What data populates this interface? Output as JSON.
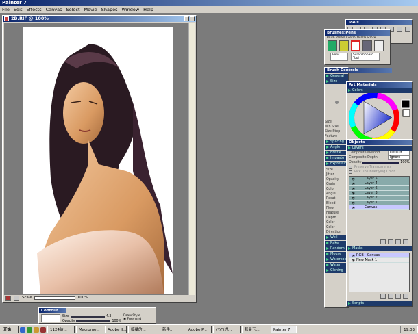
{
  "app": {
    "title": "Painter 7"
  },
  "menu": [
    "File",
    "Edit",
    "Effects",
    "Canvas",
    "Select",
    "Movie",
    "Shapes",
    "Window",
    "Help"
  ],
  "document": {
    "title": "2B.RIF @ 100%",
    "scale_label": "Scale",
    "zoom": "100%"
  },
  "tools": {
    "title": "Tools"
  },
  "brushes": {
    "title": "Brushes:Pens",
    "tabs": "Brush  Variant Control  Nozzle  Stroke",
    "category": "Pens",
    "variant": "Scratchboard Tool"
  },
  "brush_controls": {
    "title": "Brush Controls",
    "general": "General",
    "size": "Size",
    "opacity": "Opacity 100%",
    "labels": [
      "Size",
      "Min Size",
      "Size Step",
      "Feature"
    ],
    "sections": [
      "Spacing",
      "Angle",
      "Bristle",
      "Impasto",
      "Expression"
    ],
    "expr_labels": [
      "Size",
      "Jitter",
      "Opacity",
      "Grain",
      "Color",
      "Angle",
      "Resat",
      "Bleed",
      "Flow",
      "Feature",
      "Depth",
      "Color",
      "Color",
      "Direction"
    ],
    "sections2": [
      "Well",
      "Rake",
      "Random",
      "Mouse",
      "Watercolor",
      "Water",
      "Cloning"
    ]
  },
  "art_materials": {
    "title": "Art Materials",
    "colors": "Colors"
  },
  "objects": {
    "title": "Objects",
    "layers": "Layers",
    "composite_method_label": "Composite Method",
    "composite_method": "Default",
    "composite_depth_label": "Composite Depth",
    "composite_depth": "Ignore",
    "opacity_label": "Opacity",
    "opacity": "100%",
    "preserve": "Preserve Transparency",
    "pick": "Pick Up Underlying Color",
    "layers_list": [
      "Layer 5",
      "Layer 4",
      "Layer 6",
      "Layer 3",
      "Layer 2",
      "Layer 1",
      "Canvas"
    ],
    "masks": "Masks",
    "mask_items": [
      "RGB - Canvas",
      "New Mask 1"
    ],
    "scripts": "Scripts"
  },
  "contour": {
    "title": "Contour Brush",
    "size": "Size",
    "opacity": "Opacity",
    "size_val": "4.3",
    "opacity_val": "100%",
    "draw_style": "Draw Style",
    "freehand": "Freehand",
    "straight": "Straight Lines"
  },
  "taskbar": {
    "start": "开始",
    "items": [
      "1124结...",
      "Macrome...",
      "Adobe Il...",
      "临摹的...",
      "新手...",
      "Adobe P...",
      "(*)F)进...",
      "张曼玉...",
      "Painter 7"
    ],
    "clock": "19:03"
  }
}
